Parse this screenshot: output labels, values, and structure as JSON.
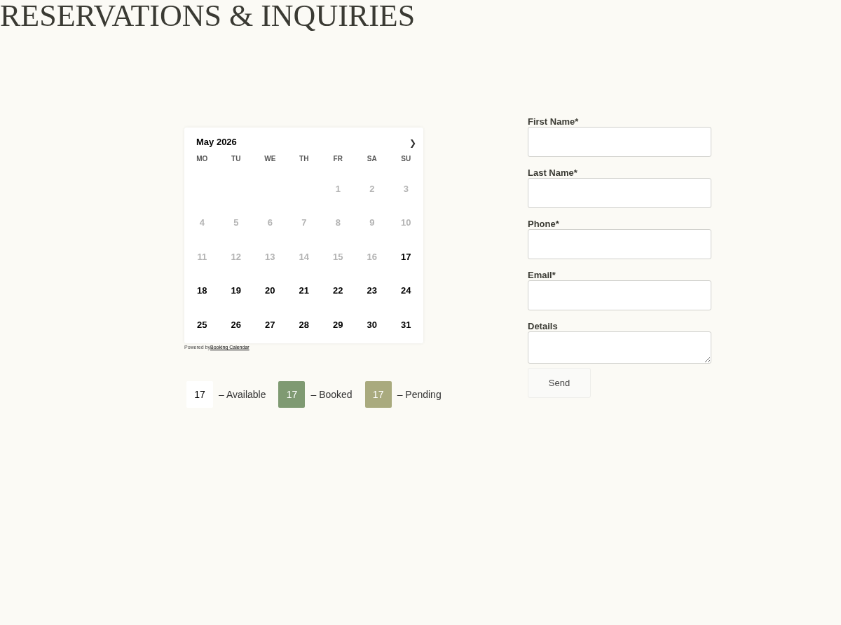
{
  "page_title": "RESERVATIONS & INQUIRIES",
  "calendar": {
    "month": "May 2026",
    "next": "❯",
    "weekdays": [
      "MO",
      "TU",
      "WE",
      "TH",
      "FR",
      "SA",
      "SU"
    ],
    "weeks": [
      {
        "days": [
          {
            "kind": "blank"
          },
          {
            "kind": "blank"
          },
          {
            "kind": "blank"
          },
          {
            "kind": "blank"
          },
          {
            "day": "1",
            "available": false
          },
          {
            "day": "2",
            "available": false
          },
          {
            "day": "3",
            "available": false
          }
        ]
      },
      {
        "days": [
          {
            "day": "4",
            "available": false
          },
          {
            "day": "5",
            "available": false
          },
          {
            "day": "6",
            "available": false
          },
          {
            "day": "7",
            "available": false
          },
          {
            "day": "8",
            "available": false
          },
          {
            "day": "9",
            "available": false
          },
          {
            "day": "10",
            "available": false
          }
        ]
      },
      {
        "days": [
          {
            "day": "11",
            "available": false
          },
          {
            "day": "12",
            "available": false
          },
          {
            "day": "13",
            "available": false
          },
          {
            "day": "14",
            "available": false
          },
          {
            "day": "15",
            "available": false
          },
          {
            "day": "16",
            "available": false
          },
          {
            "day": "17",
            "available": true
          }
        ]
      },
      {
        "days": [
          {
            "day": "18",
            "available": true
          },
          {
            "day": "19",
            "available": true
          },
          {
            "day": "20",
            "available": true
          },
          {
            "day": "21",
            "available": true
          },
          {
            "day": "22",
            "available": true
          },
          {
            "day": "23",
            "available": true
          },
          {
            "day": "24",
            "available": true
          }
        ]
      },
      {
        "days": [
          {
            "day": "25",
            "available": true
          },
          {
            "day": "26",
            "available": true
          },
          {
            "day": "27",
            "available": true
          },
          {
            "day": "28",
            "available": true
          },
          {
            "day": "29",
            "available": true
          },
          {
            "day": "30",
            "available": true
          },
          {
            "day": "31",
            "available": true
          }
        ]
      }
    ],
    "powered_by": "Powered by",
    "powered_link": "Booking Calendar"
  },
  "legend": [
    {
      "day": "17",
      "label": "– Available",
      "color": "#ffffff"
    },
    {
      "day": "17",
      "label": "– Booked",
      "color": "#7f9a72"
    },
    {
      "day": "17",
      "label": "– Pending",
      "color": "#a9aa7e"
    }
  ],
  "form": {
    "fields": [
      {
        "label": "First Name*",
        "kind": "input"
      },
      {
        "label": "Last Name*",
        "kind": "input"
      },
      {
        "label": "Phone*",
        "kind": "input"
      },
      {
        "label": "Email*",
        "kind": "input"
      },
      {
        "label": "Details",
        "kind": "textarea"
      }
    ],
    "submit": "Send"
  }
}
